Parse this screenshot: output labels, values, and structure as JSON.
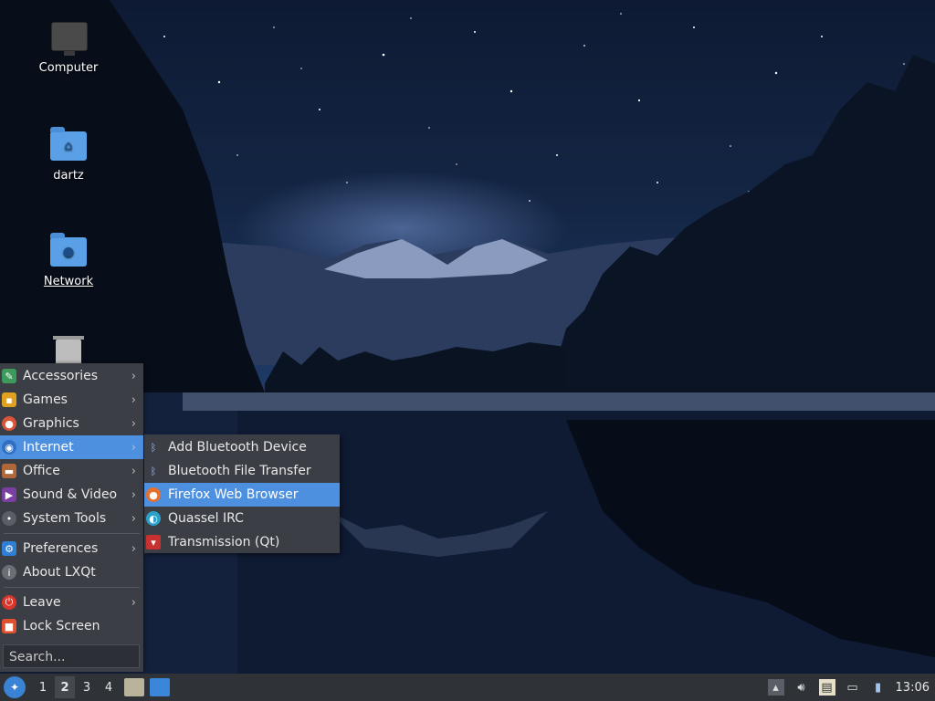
{
  "desktop_icons": [
    {
      "label": "Computer",
      "icon": "computer-icon"
    },
    {
      "label": "dartz",
      "icon": "home-folder-icon"
    },
    {
      "label": "Network",
      "icon": "network-folder-icon"
    },
    {
      "label": "",
      "icon": "trash-icon"
    }
  ],
  "menu": {
    "items": [
      {
        "label": "Accessories",
        "icon": "accessories-icon",
        "has_submenu": true
      },
      {
        "label": "Games",
        "icon": "games-icon",
        "has_submenu": true
      },
      {
        "label": "Graphics",
        "icon": "graphics-icon",
        "has_submenu": true
      },
      {
        "label": "Internet",
        "icon": "internet-icon",
        "has_submenu": true,
        "active": true
      },
      {
        "label": "Office",
        "icon": "office-icon",
        "has_submenu": true
      },
      {
        "label": "Sound & Video",
        "icon": "sound-video-icon",
        "has_submenu": true
      },
      {
        "label": "System Tools",
        "icon": "system-tools-icon",
        "has_submenu": true
      },
      {
        "label": "Preferences",
        "icon": "preferences-icon",
        "has_submenu": true
      },
      {
        "label": "About LXQt",
        "icon": "info-icon",
        "has_submenu": false
      },
      {
        "label": "Leave",
        "icon": "power-icon",
        "has_submenu": true
      },
      {
        "label": "Lock Screen",
        "icon": "lock-icon",
        "has_submenu": false
      }
    ],
    "search_placeholder": "Search..."
  },
  "submenu": {
    "items": [
      {
        "label": "Add Bluetooth Device",
        "icon": "bluetooth-icon"
      },
      {
        "label": "Bluetooth File Transfer",
        "icon": "bluetooth-icon"
      },
      {
        "label": "Firefox Web Browser",
        "icon": "firefox-icon",
        "active": true
      },
      {
        "label": "Quassel IRC",
        "icon": "quassel-icon"
      },
      {
        "label": "Transmission (Qt)",
        "icon": "transmission-icon"
      }
    ]
  },
  "taskbar": {
    "desktops": [
      "1",
      "2",
      "3",
      "4"
    ],
    "current_desktop": "2",
    "clock": "13:06"
  },
  "colors": {
    "menu_bg": "#3b3e45",
    "highlight": "#4e90e0",
    "taskbar_bg": "#2f3237"
  }
}
